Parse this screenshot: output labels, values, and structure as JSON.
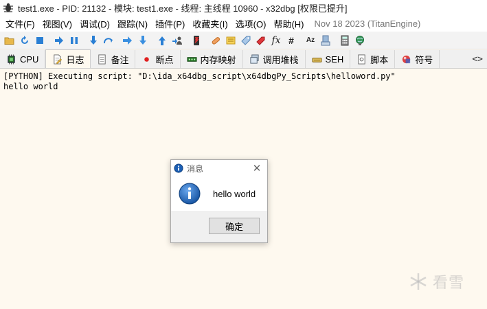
{
  "window": {
    "title": "test1.exe - PID: 21132 - 模块: test1.exe - 线程: 主线程 10960 - x32dbg [权限已提升]"
  },
  "menu": {
    "items": [
      "文件(F)",
      "视图(V)",
      "调试(D)",
      "跟踪(N)",
      "插件(P)",
      "收藏夹(I)",
      "选项(O)",
      "帮助(H)"
    ],
    "build": "Nov 18 2023 (TitanEngine)"
  },
  "toolbar": {
    "icons": [
      "open-icon",
      "restart-icon",
      "stop-icon",
      "run-icon",
      "pause-icon",
      "step-into-icon",
      "step-over-icon",
      "trace-into-icon",
      "trace-over-icon",
      "run-to-user-icon",
      "execute-till-return-icon",
      "scylla-icon",
      "patch-icon",
      "comments-icon",
      "labels-icon",
      "bookmarks-icon",
      "functions-icon",
      "variables-icon",
      "strings-icon",
      "symbols-icon",
      "calculator-icon",
      "settings-icon"
    ],
    "fx_label": "fx",
    "hash_label": "#",
    "az_label": "Az"
  },
  "tabs": [
    {
      "label": "CPU",
      "icon": "cpu-icon",
      "active": false
    },
    {
      "label": "日志",
      "icon": "log-icon",
      "active": true
    },
    {
      "label": "备注",
      "icon": "notes-icon",
      "active": false
    },
    {
      "label": "断点",
      "icon": "breakpoint-icon",
      "active": false
    },
    {
      "label": "内存映射",
      "icon": "memory-map-icon",
      "active": false
    },
    {
      "label": "调用堆栈",
      "icon": "call-stack-icon",
      "active": false
    },
    {
      "label": "SEH",
      "icon": "seh-icon",
      "active": false
    },
    {
      "label": "脚本",
      "icon": "script-icon",
      "active": false
    },
    {
      "label": "符号",
      "icon": "symbols-tab-icon",
      "active": false
    }
  ],
  "tab_overflow": "<>",
  "log": {
    "lines": [
      "[PYTHON] Executing script: \"D:\\ida_x64dbg_script\\x64dbgPy_Scripts\\helloword.py\"",
      "hello world"
    ]
  },
  "dialog": {
    "title": "消息",
    "message": "hello world",
    "ok_label": "确定",
    "close_glyph": "✕"
  },
  "watermark": {
    "text": "看雪"
  },
  "colors": {
    "log_background": "#fef9ef",
    "info_blue": "#1c5fb4"
  }
}
